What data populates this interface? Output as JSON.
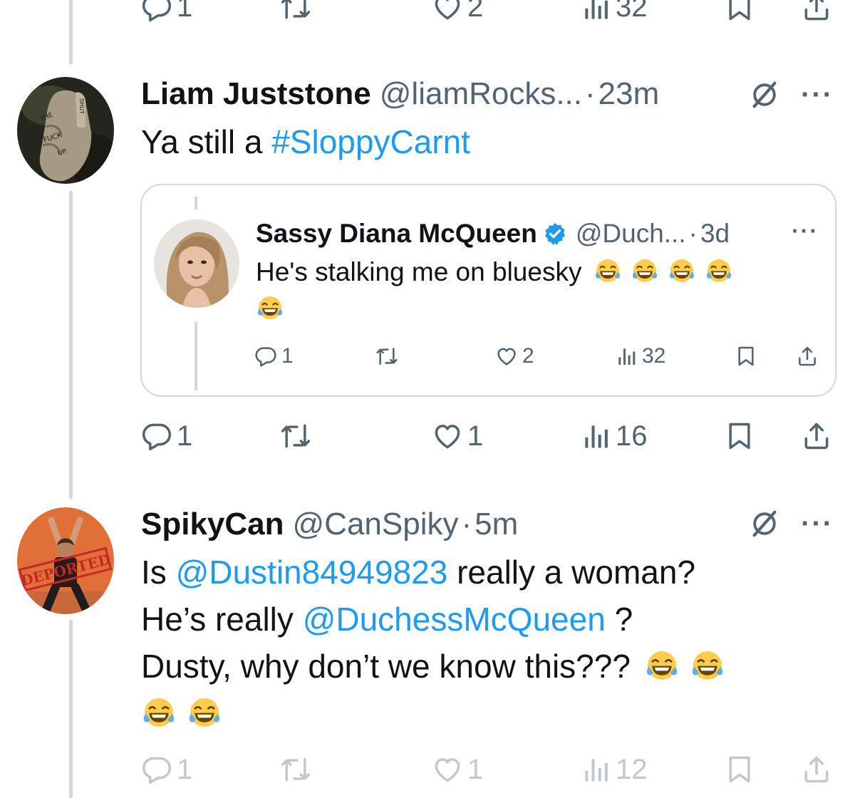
{
  "top_actions": {
    "replies": "1",
    "likes": "2",
    "views": "32"
  },
  "tweet1": {
    "name": "Liam Juststone",
    "handle": "@liamRocks...",
    "dot": "·",
    "time": "23m",
    "text_prefix": "Ya still a ",
    "hashtag": "#SloppyCarnt",
    "avatar_lettering": "SHUT THE FUCK UP",
    "actions": {
      "replies": "1",
      "likes": "1",
      "views": "16"
    },
    "quote": {
      "name": "Sassy Diana McQueen",
      "handle": "@Duch...",
      "dot": "·",
      "time": "3d",
      "text": "He's stalking me on bluesky",
      "actions": {
        "replies": "1",
        "likes": "2",
        "views": "32"
      }
    }
  },
  "tweet2": {
    "name": "SpikyCan",
    "handle": "@CanSpiky",
    "dot": "·",
    "time": "5m",
    "line1_prefix": "Is ",
    "mention1": "@Dustin84949823",
    "line1_suffix": " really a woman?",
    "line2_prefix": "He’s really ",
    "mention2": "@DuchessMcQueen",
    "line2_suffix": " ?",
    "line3": "Dusty, why don’t we know this???",
    "avatar_stamp": "DEPORTED",
    "actions": {
      "replies": "1",
      "likes": "1",
      "views": "12"
    }
  },
  "more_glyph": "···",
  "colors": {
    "text": "#0f1419",
    "secondary": "#536471",
    "link": "#1d9bf0",
    "border": "#cfd9de",
    "verified": "#1d9bf0"
  },
  "icons": [
    "reply-icon",
    "retweet-icon",
    "like-icon",
    "views-icon",
    "bookmark-icon",
    "share-icon",
    "grok-icon",
    "more-icon",
    "verified-icon",
    "laughing-emoji"
  ]
}
